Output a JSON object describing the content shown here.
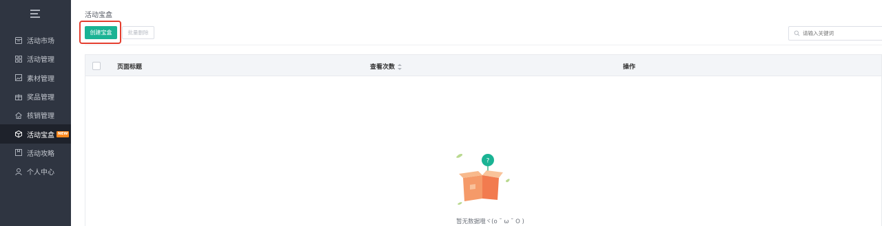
{
  "sidebar": {
    "items": [
      {
        "label": "活动市场",
        "icon": "calendar-icon"
      },
      {
        "label": "活动管理",
        "icon": "grid-icon"
      },
      {
        "label": "素材管理",
        "icon": "image-icon"
      },
      {
        "label": "奖品管理",
        "icon": "gift-icon"
      },
      {
        "label": "核销管理",
        "icon": "home-check-icon"
      },
      {
        "label": "活动宝盒",
        "icon": "box-icon",
        "badge": "NEW",
        "active": true
      },
      {
        "label": "活动攻略",
        "icon": "bookmark-icon"
      },
      {
        "label": "个人中心",
        "icon": "user-icon"
      }
    ]
  },
  "main": {
    "breadcrumb": "活动宝盒",
    "create_label": "创建宝盒",
    "bulk_delete_label": "批量删除",
    "search_placeholder": "请输入关键词",
    "table": {
      "columns": [
        "页面标题",
        "查看次数",
        "操作"
      ]
    },
    "empty_text": "暂无数据哦ヾ(o ˘ ω ˘ O )"
  },
  "colors": {
    "sidebar_bg": "#2f3541",
    "accent": "#1ab394",
    "highlight": "#e43d2e",
    "badge": "#ff8a1f"
  }
}
